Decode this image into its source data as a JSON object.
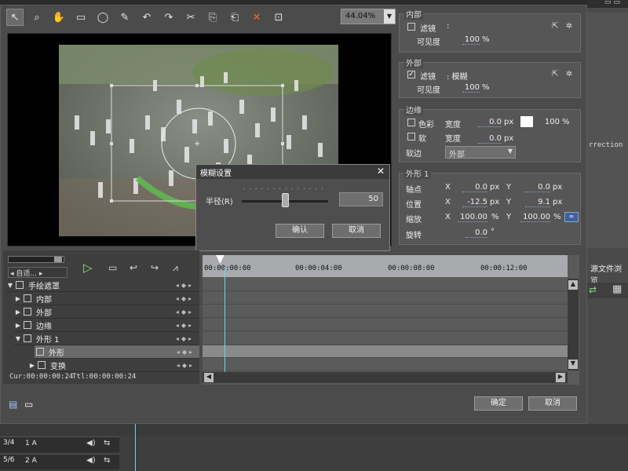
{
  "toolbar": {
    "zoom_value": "44.04%"
  },
  "panels": {
    "inner": {
      "title": "内部",
      "filter_label": "滤镜",
      "filter_value": ":",
      "visibility_label": "可见度",
      "visibility_value": "100",
      "visibility_unit": "%"
    },
    "outer": {
      "title": "外部",
      "filter_label": "滤镜",
      "filter_value": ":  模糊",
      "visibility_label": "可见度",
      "visibility_value": "100",
      "visibility_unit": "%"
    },
    "edge": {
      "title": "边缘",
      "color_label": "色彩",
      "width_label": "宽度",
      "color_width_value": "0.0",
      "px": "px",
      "color_percent": "100",
      "percent": "%",
      "soft_label": "软",
      "soft_width_value": "0.0",
      "soft_edge_label": "软边",
      "soft_edge_value": "外部"
    },
    "shape": {
      "title": "外形 1",
      "anchor_label": "轴点",
      "anchor_x": "0.0",
      "anchor_y": "0.0",
      "position_label": "位置",
      "position_x": "-12.5",
      "position_y": "9.1",
      "scale_label": "缩放",
      "scale_x": "100.00",
      "scale_y": "100.00",
      "rotate_label": "旋转",
      "rotate_value": "0.0",
      "degree": "°",
      "x": "X",
      "y": "Y"
    }
  },
  "blur_dialog": {
    "title": "模糊设置",
    "radius_label": "半径(R)",
    "radius_value": "50",
    "ok_label": "确认",
    "cancel_label": "取消",
    "radius_fraction": 0.5
  },
  "track_tree": {
    "combo_label": "自适...",
    "items": [
      {
        "label": "手绘遮罩"
      },
      {
        "label": "内部"
      },
      {
        "label": "外部"
      },
      {
        "label": "边缘"
      },
      {
        "label": "外形 1"
      },
      {
        "label": "外形"
      },
      {
        "label": "变换"
      }
    ],
    "cur_label": "Cur:00:00:00:24",
    "ttl_label": "Ttl:00:00:00:24"
  },
  "timeline": {
    "ticks": [
      "00:00:00:00",
      "00:00:04:00",
      "00:00:08:00",
      "00:00:12:00"
    ]
  },
  "footer": {
    "ok_label": "确定",
    "cancel_label": "取消"
  },
  "right_side": {
    "source_browser": "源文件浏览",
    "correction_text": "rrection"
  },
  "bottom_tracks": [
    {
      "track_id": "3/4",
      "label": "1 A"
    },
    {
      "track_id": "5/6",
      "label": "2 A"
    }
  ]
}
